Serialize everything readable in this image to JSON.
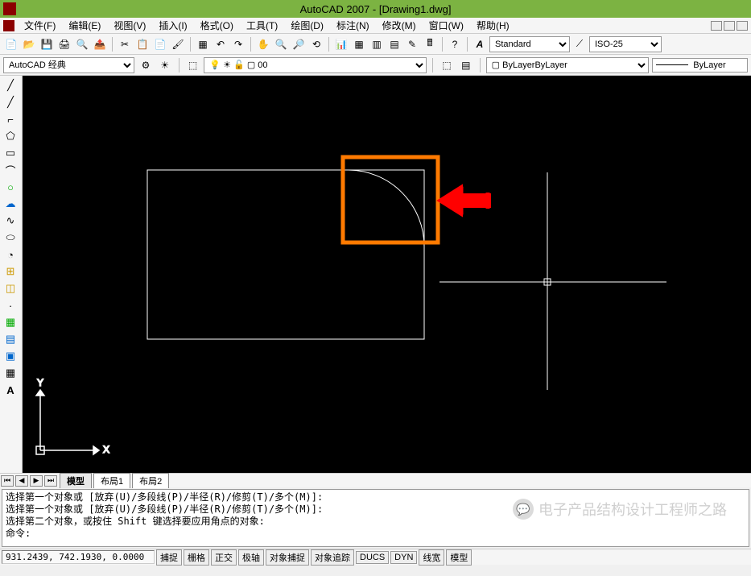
{
  "title": "AutoCAD 2007 - [Drawing1.dwg]",
  "menu": {
    "file": "文件(F)",
    "edit": "编辑(E)",
    "view": "视图(V)",
    "insert": "插入(I)",
    "format": "格式(O)",
    "tools": "工具(T)",
    "draw": "绘图(D)",
    "dimension": "标注(N)",
    "modify": "修改(M)",
    "window": "窗口(W)",
    "help": "帮助(H)"
  },
  "toolbar1": {
    "text_style": "Standard",
    "dim_style": "ISO-25"
  },
  "toolbar2": {
    "workspace": "AutoCAD 经典",
    "layer": "0",
    "bylayer": "ByLayer",
    "lineweight": "ByLayer"
  },
  "left_tools": [
    {
      "name": "line-tool",
      "glyph": "╱"
    },
    {
      "name": "construction-line-tool",
      "glyph": "╱"
    },
    {
      "name": "polyline-tool",
      "glyph": "⌐"
    },
    {
      "name": "polygon-tool",
      "glyph": "⬠"
    },
    {
      "name": "rectangle-tool",
      "glyph": "▭"
    },
    {
      "name": "arc-tool",
      "glyph": "⌒"
    },
    {
      "name": "circle-tool",
      "glyph": "○"
    },
    {
      "name": "revision-cloud-tool",
      "glyph": "☁"
    },
    {
      "name": "spline-tool",
      "glyph": "∿"
    },
    {
      "name": "ellipse-tool",
      "glyph": "⬭"
    },
    {
      "name": "ellipse-arc-tool",
      "glyph": "◔"
    },
    {
      "name": "insert-block-tool",
      "glyph": "⊞"
    },
    {
      "name": "make-block-tool",
      "glyph": "◫"
    },
    {
      "name": "point-tool",
      "glyph": "·"
    },
    {
      "name": "hatch-tool",
      "glyph": "▦"
    },
    {
      "name": "gradient-tool",
      "glyph": "▤"
    },
    {
      "name": "region-tool",
      "glyph": "▣"
    },
    {
      "name": "table-tool",
      "glyph": "▦"
    },
    {
      "name": "mtext-tool",
      "glyph": "A"
    }
  ],
  "tabs": {
    "model": "模型",
    "layout1": "布局1",
    "layout2": "布局2"
  },
  "cmd": {
    "line1": "选择第一个对象或 [放弃(U)/多段线(P)/半径(R)/修剪(T)/多个(M)]:",
    "line2": "选择第一个对象或 [放弃(U)/多段线(P)/半径(R)/修剪(T)/多个(M)]:",
    "line3": "选择第二个对象，或按住 Shift 键选择要应用角点的对象:",
    "prompt": "命令:"
  },
  "status": {
    "coords": "931.2439, 742.1930, 0.0000",
    "snap": "捕捉",
    "grid": "栅格",
    "ortho": "正交",
    "polar": "极轴",
    "osnap": "对象捕捉",
    "otrack": "对象追踪",
    "ducs": "DUCS",
    "dyn": "DYN",
    "lwt": "线宽",
    "model": "模型"
  },
  "axis": {
    "x": "X",
    "y": "Y"
  },
  "watermark": "电子产品结构设计工程师之路"
}
